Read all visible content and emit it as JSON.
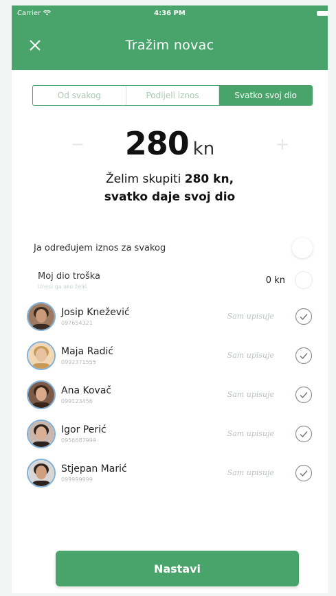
{
  "status_bar": {
    "carrier": "Carrier",
    "time": "4:36 PM"
  },
  "nav": {
    "title": "Tražim novac",
    "close_icon": "close-icon"
  },
  "segments": [
    {
      "label": "Od svakog",
      "active": false
    },
    {
      "label": "Podijeli iznos",
      "active": false
    },
    {
      "label": "Svatko svoj dio",
      "active": true
    }
  ],
  "amount": {
    "value": "280",
    "unit": "kn",
    "minus": "−",
    "plus": "+"
  },
  "summary": {
    "prefix": "Želim skupiti ",
    "amount": "280 kn,",
    "line2": "svatko daje svoj dio"
  },
  "option": {
    "label": "Ja određujem iznos za svakog"
  },
  "my_part": {
    "label": "Moj dio troška",
    "hint": "Unesi ga ako želiš",
    "amount": "0",
    "unit": "kn"
  },
  "people": [
    {
      "name": "Josip Knežević",
      "phone": "097654321",
      "status": "Sam upisuje",
      "skin": "#c99b7a",
      "hair": "#3a2a20",
      "bg": "#9c7b62"
    },
    {
      "name": "Maja Radić",
      "phone": "0992371555",
      "status": "Sam upisuje",
      "skin": "#e8c2a0",
      "hair": "#c89a55",
      "bg": "#f0d7b5"
    },
    {
      "name": "Ana Kovač",
      "phone": "099123456",
      "status": "Sam upisuje",
      "skin": "#d8a98a",
      "hair": "#3b2518",
      "bg": "#7a5a48"
    },
    {
      "name": "Igor Perić",
      "phone": "0956687999",
      "status": "Sam upisuje",
      "skin": "#d9b096",
      "hair": "#2c211b",
      "bg": "#c7b7ae"
    },
    {
      "name": "Stjepan Marić",
      "phone": "099999999",
      "status": "Sam upisuje",
      "skin": "#cfa07f",
      "hair": "#2e231d",
      "bg": "#d7d7d7"
    }
  ],
  "continue_button": {
    "label": "Nastavi"
  },
  "colors": {
    "accent": "#49a46b",
    "avatar_ring": "#7fb0d8"
  }
}
